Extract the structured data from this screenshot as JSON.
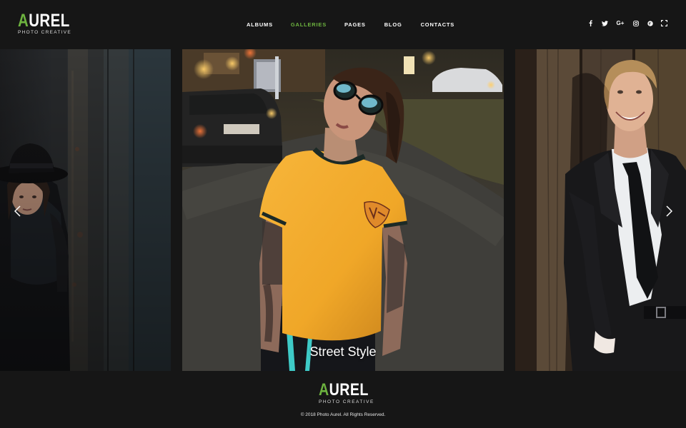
{
  "brand": {
    "name_accent": "A",
    "name_rest": "UREL",
    "tagline": "PHOTO CREATIVE",
    "accent_color": "#6db33f"
  },
  "nav": {
    "items": [
      {
        "label": "ALBUMS",
        "active": false
      },
      {
        "label": "GALLERIES",
        "active": true
      },
      {
        "label": "PAGES",
        "active": false
      },
      {
        "label": "BLOG",
        "active": false
      },
      {
        "label": "CONTACTS",
        "active": false
      }
    ]
  },
  "social": {
    "icons": [
      "facebook-icon",
      "twitter-icon",
      "google-plus-icon",
      "instagram-icon",
      "pinterest-icon",
      "fullscreen-icon"
    ],
    "google_plus_label": "G+"
  },
  "gallery": {
    "slides": [
      {
        "caption": ""
      },
      {
        "caption": "Street Style"
      },
      {
        "caption": ""
      }
    ],
    "prev_icon": "chevron-left-icon",
    "next_icon": "chevron-right-icon"
  },
  "footer": {
    "copyright": "© 2018 Photo Aurel. All Rights Reserved."
  }
}
